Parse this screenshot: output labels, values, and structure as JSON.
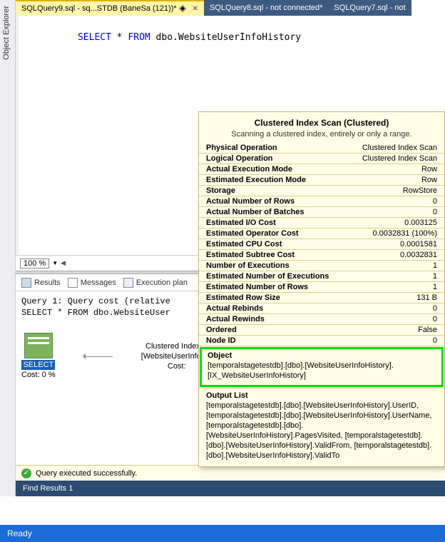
{
  "explorer_label": "Object Explorer",
  "tabs": [
    {
      "label": "SQLQuery9.sql - sq...STDB (BaneSa (121))*",
      "active": true
    },
    {
      "label": "SQLQuery8.sql - not connected*",
      "active": false
    },
    {
      "label": "SQLQuery7.sql - not",
      "active": false
    }
  ],
  "sql": {
    "kw_select": "SELECT",
    "star": " * ",
    "kw_from": "FROM",
    "obj": " dbo.WebsiteUserInfoHistory"
  },
  "zoom": "100 %",
  "result_tabs": {
    "results": "Results",
    "messages": "Messages",
    "plan": "Execution plan"
  },
  "plan_header": "Query 1: Query cost (relative",
  "plan_sql": "SELECT * FROM dbo.WebsiteUser",
  "op_select": {
    "label": "SELECT",
    "cost": "Cost: 0 %"
  },
  "op_scan": {
    "l1": "Clustered Index S",
    "l2": "[WebsiteUserInfoHis",
    "l3": "Cost:"
  },
  "status": "Query executed successfully.",
  "find_label": "Find Results 1",
  "ready": "Ready",
  "tooltip": {
    "title": "Clustered Index Scan (Clustered)",
    "desc": "Scanning a clustered index, entirely or only a range.",
    "rows": [
      [
        "Physical Operation",
        "Clustered Index Scan"
      ],
      [
        "Logical Operation",
        "Clustered Index Scan"
      ],
      [
        "Actual Execution Mode",
        "Row"
      ],
      [
        "Estimated Execution Mode",
        "Row"
      ],
      [
        "Storage",
        "RowStore"
      ],
      [
        "Actual Number of Rows",
        "0"
      ],
      [
        "Actual Number of Batches",
        "0"
      ],
      [
        "Estimated I/O Cost",
        "0.003125"
      ],
      [
        "Estimated Operator Cost",
        "0.0032831 (100%)"
      ],
      [
        "Estimated CPU Cost",
        "0.0001581"
      ],
      [
        "Estimated Subtree Cost",
        "0.0032831"
      ],
      [
        "Number of Executions",
        "1"
      ],
      [
        "Estimated Number of Executions",
        "1"
      ],
      [
        "Estimated Number of Rows",
        "1"
      ],
      [
        "Estimated Row Size",
        "131 B"
      ],
      [
        "Actual Rebinds",
        "0"
      ],
      [
        "Actual Rewinds",
        "0"
      ],
      [
        "Ordered",
        "False"
      ],
      [
        "Node ID",
        "0"
      ]
    ],
    "object": {
      "title": "Object",
      "body": "[temporalstagetestdb].[dbo].[WebsiteUserInfoHistory].[IX_WebsiteUserInfoHistory]"
    },
    "output": {
      "title": "Output List",
      "body": "[temporalstagetestdb].[dbo].[WebsiteUserInfoHistory].UserID, [temporalstagetestdb].[dbo].[WebsiteUserInfoHistory].UserName, [temporalstagetestdb].[dbo].[WebsiteUserInfoHistory].PagesVisited, [temporalstagetestdb].[dbo].[WebsiteUserInfoHistory].ValidFrom, [temporalstagetestdb].[dbo].[WebsiteUserInfoHistory].ValidTo"
    }
  }
}
